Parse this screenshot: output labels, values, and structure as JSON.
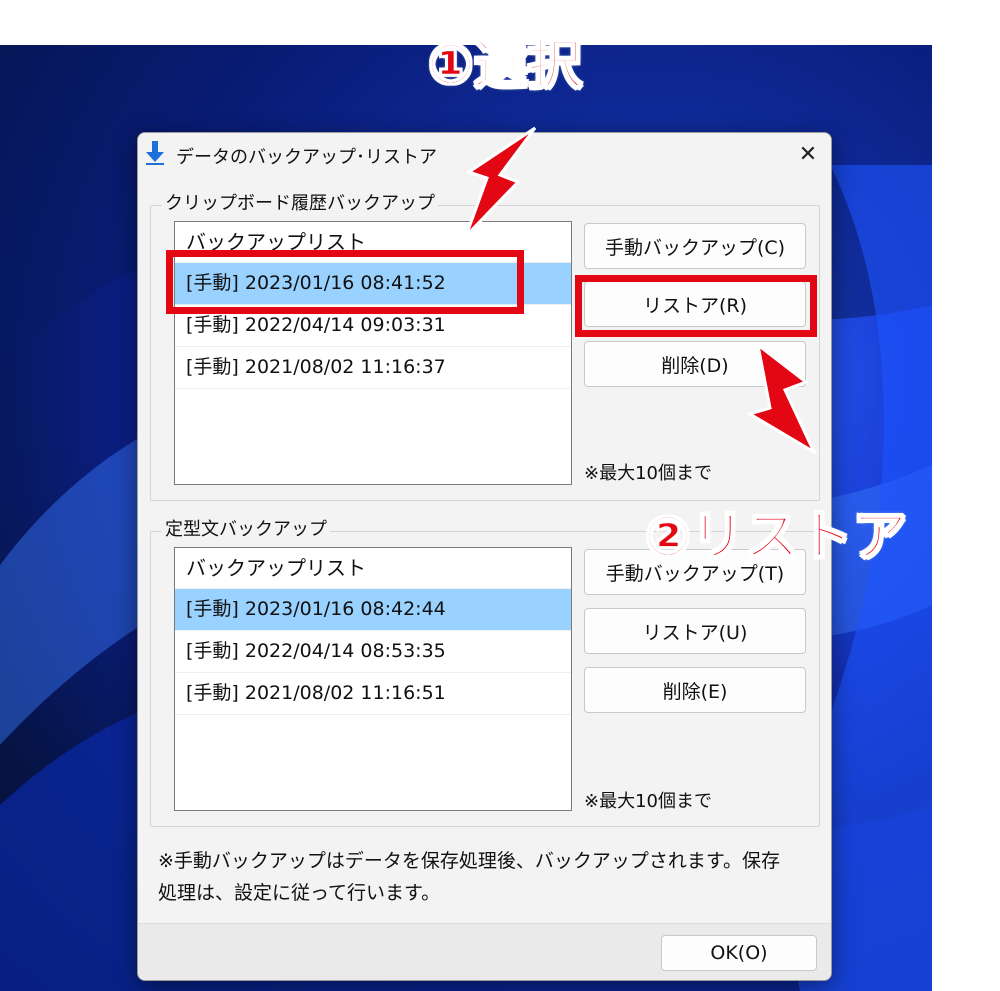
{
  "dialog": {
    "title": "データのバックアップ･リストア",
    "close_icon": "close-icon"
  },
  "clipboard_group": {
    "label": "クリップボード履歴バックアップ",
    "list_header": "バックアップリスト",
    "rows": [
      "[手動] 2023/01/16 08:41:52",
      "[手動] 2022/04/14 09:03:31",
      "[手動] 2021/08/02 11:16:37"
    ],
    "selected_index": 0,
    "buttons": {
      "backup": "手動バックアップ(C)",
      "restore": "リストア(R)",
      "delete": "削除(D)"
    },
    "note": "※最大10個まで"
  },
  "template_group": {
    "label": "定型文バックアップ",
    "list_header": "バックアップリスト",
    "rows": [
      "[手動] 2023/01/16 08:42:44",
      "[手動] 2022/04/14 08:53:35",
      "[手動] 2021/08/02 11:16:51"
    ],
    "selected_index": 0,
    "buttons": {
      "backup": "手動バックアップ(T)",
      "restore": "リストア(U)",
      "delete": "削除(E)"
    },
    "note": "※最大10個まで"
  },
  "footer_note": "※手動バックアップはデータを保存処理後、バックアップされます。保存処理は、設定に従って行います。",
  "ok_label": "OK(O)",
  "annotations": {
    "step1": "①選択",
    "step2": "②リストア",
    "color": "#e30613"
  }
}
